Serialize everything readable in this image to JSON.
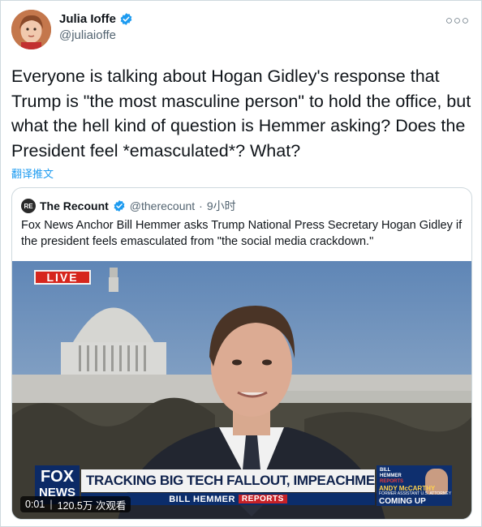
{
  "tweet": {
    "author_name": "Julia Ioffe",
    "author_handle": "@juliaioffe",
    "text": "Everyone is talking about Hogan Gidley's response that Trump is \"the most masculine person\" to hold the office, but what the hell kind of question is Hemmer asking? Does the President feel *emasculated*? What?",
    "translate_label": "翻译推文",
    "more_icon": "more-horizontal-icon"
  },
  "quoted_tweet": {
    "avatar_text": "RE",
    "author_name": "The Recount",
    "author_handle": "@therecount",
    "separator": "·",
    "time": "9小时",
    "text": "Fox News Anchor Bill Hemmer asks Trump National Press Secretary Hogan Gidley if the president feels emasculated from \"the social media crackdown.\""
  },
  "video": {
    "live_label": "LIVE",
    "channel_logo_top": "FOX",
    "channel_logo_bottom": "NEWS",
    "headline": "TRACKING BIG TECH FALLOUT, IMPEACHMENT NEXT STEPS",
    "show_name": "BILL HEMMER",
    "show_suffix": "REPORTS",
    "side_top_line1": "BILL",
    "side_top_line2": "HEMMER",
    "side_top_line3": "REPORTS",
    "side_name": "ANDY McCARTHY",
    "side_role": "FORMER ASSISTANT U.S. ATTORNEY",
    "side_coming": "COMING UP",
    "time": "0:01",
    "views": "120.5万 次观看",
    "separator": "|"
  },
  "colors": {
    "accent": "#1d9bf0",
    "verified": "#1d9bf0",
    "live_red": "#d6261d",
    "fox_navy": "#0c2a66"
  }
}
